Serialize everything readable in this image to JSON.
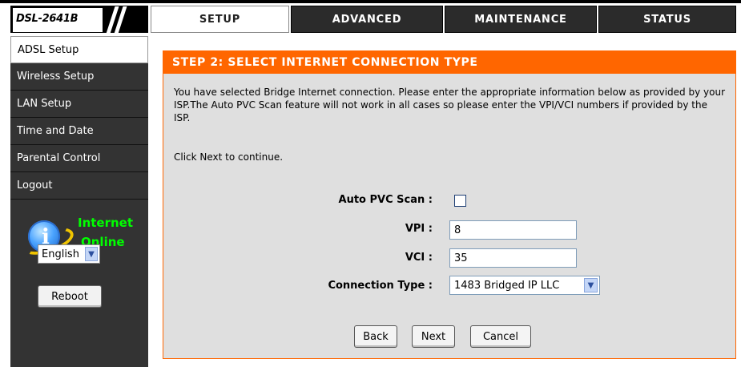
{
  "header": {
    "model": "DSL-2641B",
    "tabs": [
      {
        "label": "SETUP",
        "active": true
      },
      {
        "label": "ADVANCED",
        "active": false
      },
      {
        "label": "MAINTENANCE",
        "active": false
      },
      {
        "label": "STATUS",
        "active": false
      }
    ]
  },
  "sidebar": {
    "items": [
      {
        "label": "ADSL Setup",
        "active": true
      },
      {
        "label": "Wireless Setup",
        "active": false
      },
      {
        "label": "LAN Setup",
        "active": false
      },
      {
        "label": "Time and Date",
        "active": false
      },
      {
        "label": "Parental Control",
        "active": false
      },
      {
        "label": "Logout",
        "active": false
      }
    ],
    "internet_status": {
      "line1": "Internet",
      "line2": "Online",
      "icon": "internet-globe-icon"
    },
    "language": {
      "selected": "English"
    },
    "reboot_label": "Reboot"
  },
  "main": {
    "title": "STEP 2: SELECT INTERNET CONNECTION TYPE",
    "description": "You have selected Bridge Internet connection. Please enter the appropriate information below as provided by your ISP.The Auto PVC Scan feature will not work in all cases so please enter the VPI/VCI numbers if provided by the ISP.",
    "continue_text": "Click Next to continue.",
    "form": {
      "auto_pvc_label": "Auto PVC Scan :",
      "auto_pvc_checked": false,
      "vpi_label": "VPI :",
      "vpi_value": "8",
      "vci_label": "VCI :",
      "vci_value": "35",
      "connection_type_label": "Connection Type :",
      "connection_type_value": "1483 Bridged IP LLC"
    },
    "buttons": {
      "back": "Back",
      "next": "Next",
      "cancel": "Cancel"
    }
  },
  "colors": {
    "accent": "#ff6600",
    "sidebar_bg": "#333333",
    "panel_bg": "#dfdfdf",
    "status_text": "#00ff00"
  }
}
